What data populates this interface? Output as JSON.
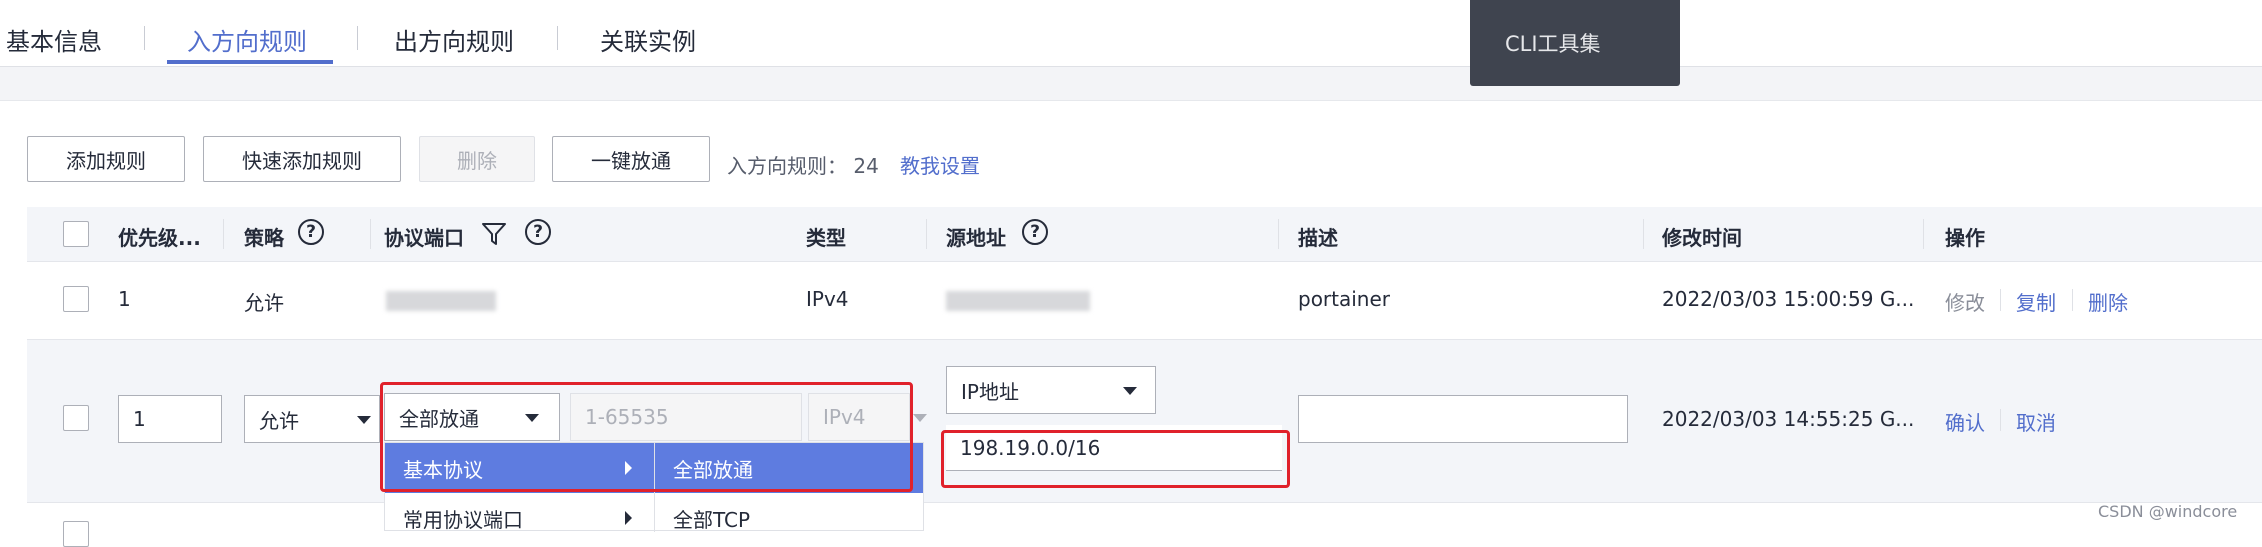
{
  "tabs": [
    {
      "label": "基本信息"
    },
    {
      "label": "入方向规则",
      "active": true
    },
    {
      "label": "出方向规则"
    },
    {
      "label": "关联实例"
    }
  ],
  "cli_tooltip": "CLI工具集",
  "toolbar": {
    "add_rule": "添加规则",
    "quick_add_rule": "快速添加规则",
    "delete": "删除",
    "allow_all": "一键放通",
    "rule_count_label": "入方向规则：",
    "rule_count": "24",
    "help_link": "教我设置"
  },
  "table": {
    "headers": {
      "priority": "优先级...",
      "policy": "策略",
      "protocol_port": "协议端口",
      "type": "类型",
      "source": "源地址",
      "description": "描述",
      "modified": "修改时间",
      "actions": "操作"
    },
    "row1": {
      "priority": "1",
      "policy": "允许",
      "type": "IPv4",
      "description": "portainer",
      "modified": "2022/03/03 15:00:59 G...",
      "action_edit": "修改",
      "action_copy": "复制",
      "action_delete": "删除"
    },
    "edit_row": {
      "priority": "1",
      "policy": "允许",
      "protocol": "全部放通",
      "port_placeholder": "1-65535",
      "type": "IPv4",
      "source_type": "IP地址",
      "source_value": "198.19.0.0/16",
      "description": "",
      "modified": "2022/03/03 14:55:25 G...",
      "action_confirm": "确认",
      "action_cancel": "取消"
    }
  },
  "protocol_menu": {
    "left": [
      "基本协议",
      "常用协议端口"
    ],
    "right": [
      "全部放通",
      "全部TCP"
    ]
  },
  "watermark": "CSDN @windcore",
  "colors": {
    "accent": "#526ecc",
    "menu_selected": "#5e7ce0",
    "highlight_box": "#e0212b"
  }
}
